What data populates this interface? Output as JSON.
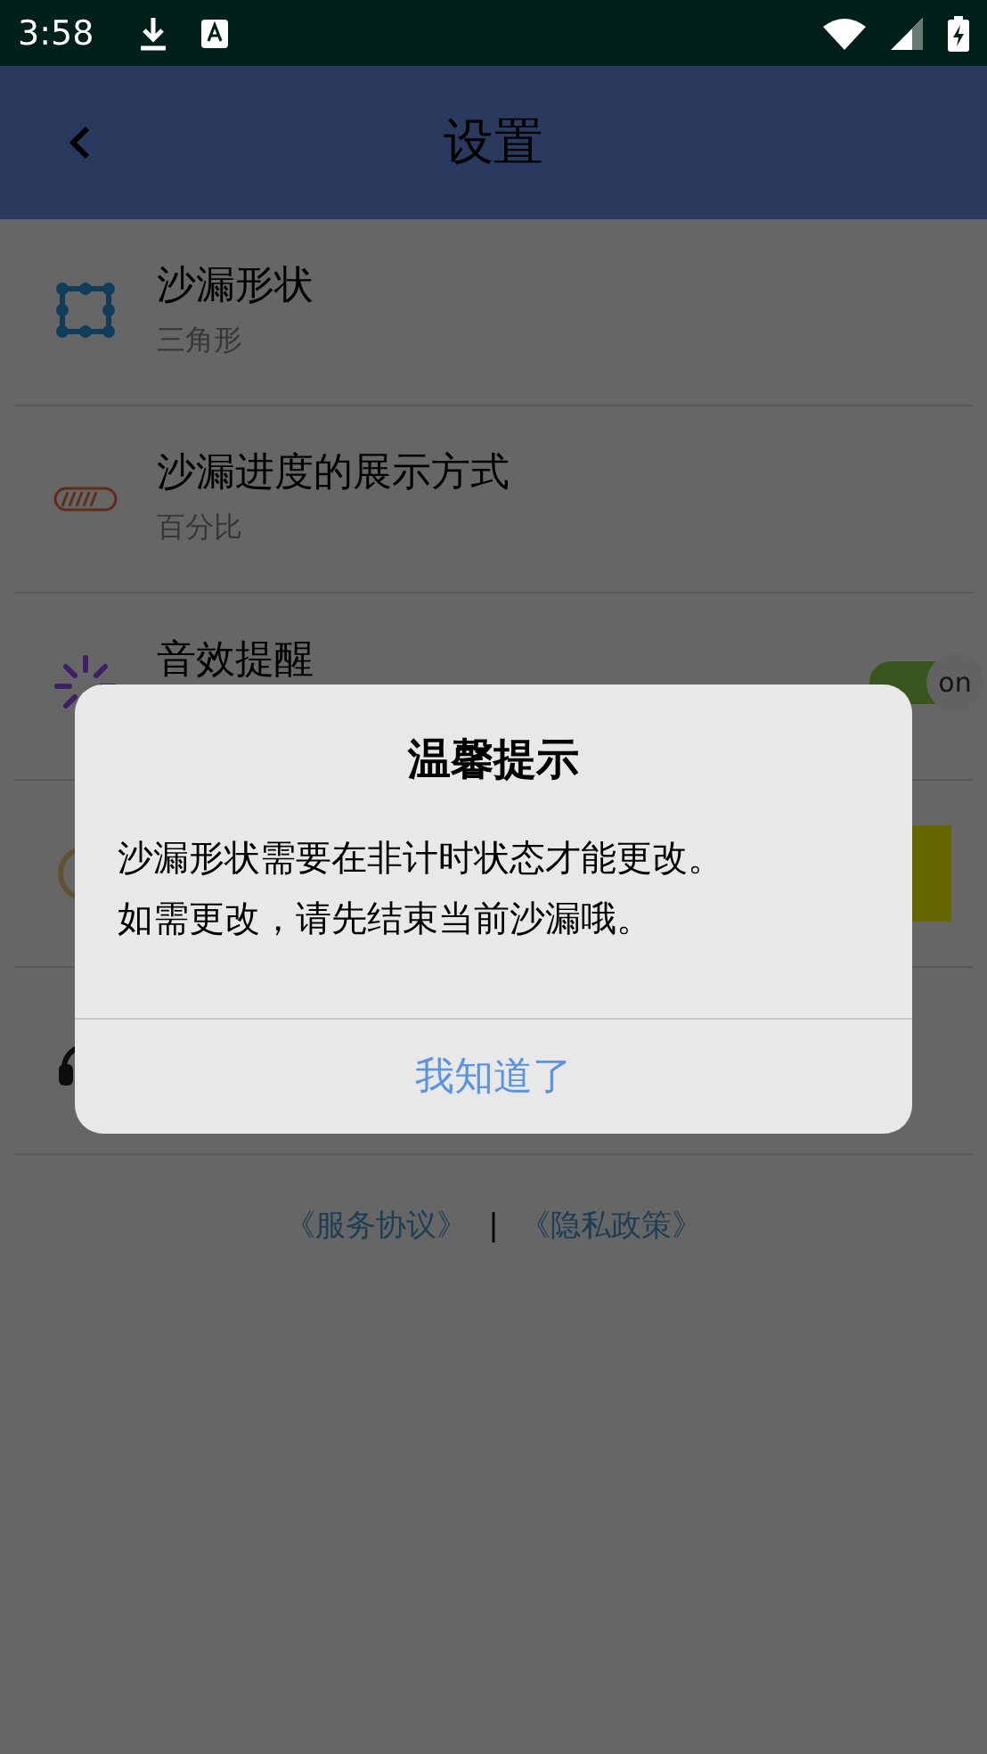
{
  "status_bar": {
    "time": "3:58"
  },
  "app_bar": {
    "title": "设置"
  },
  "settings": [
    {
      "kind": "option",
      "title": "沙漏形状",
      "value": "三角形"
    },
    {
      "kind": "option",
      "title": "沙漏进度的展示方式",
      "value": "百分比"
    },
    {
      "kind": "toggle",
      "title": "音效提醒",
      "on": true,
      "toggle_text": "on"
    },
    {
      "kind": "button"
    },
    {
      "kind": "plain"
    }
  ],
  "footer": {
    "links": [
      "《服务协议》",
      "《隐私政策》"
    ],
    "separator": "|"
  },
  "dialog": {
    "title": "温馨提示",
    "message": [
      "沙漏形状需要在非计时状态才能更改。",
      "如需更改，请先结束当前沙漏哦。"
    ],
    "button": "我知道了"
  }
}
